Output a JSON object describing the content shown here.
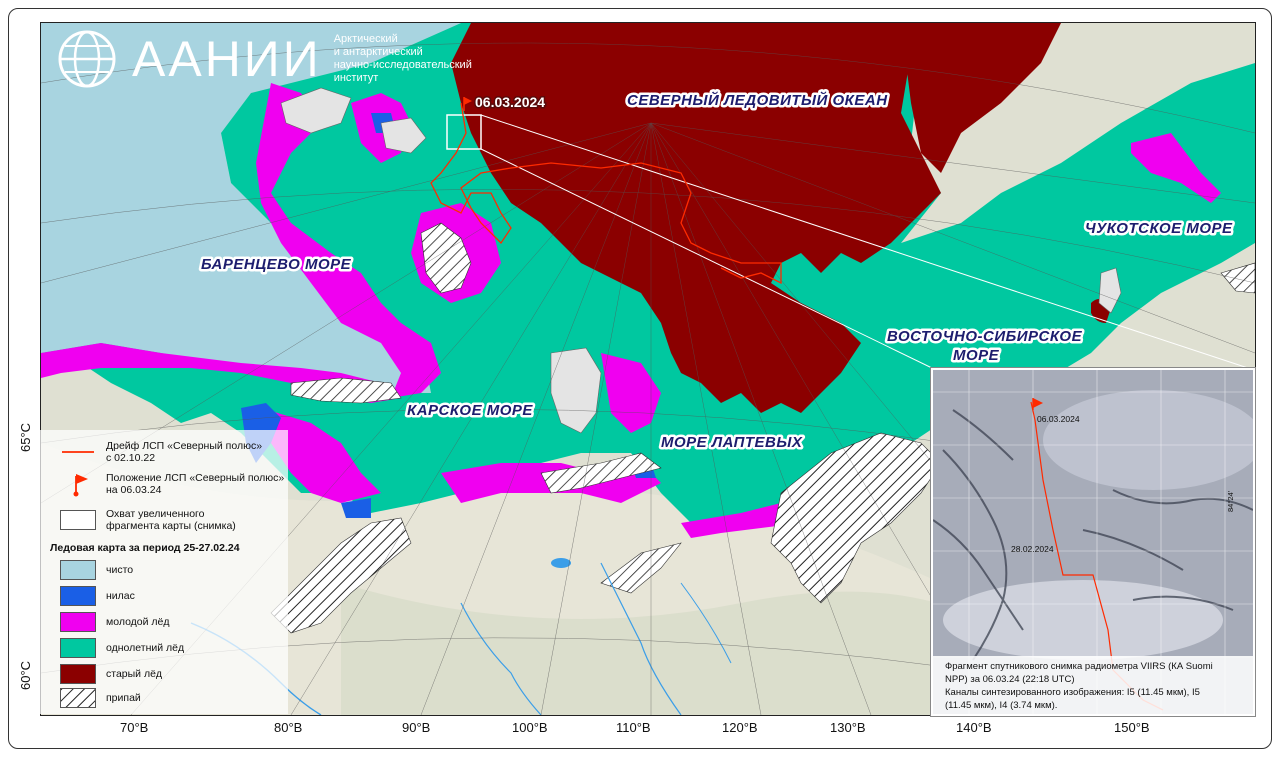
{
  "logo": {
    "name": "ААНИИ",
    "subtitle_lines": [
      "Арктический",
      "и антарктический",
      "научно-исследовательский",
      "институт"
    ]
  },
  "map_labels": {
    "ocean": "СЕВЕРНЫЙ ЛЕДОВИТЫЙ ОКЕАН",
    "barents": "БАРЕНЦЕВО МОРЕ",
    "kara": "КАРСКОЕ МОРЕ",
    "laptev": "МОРЕ ЛАПТЕВЫХ",
    "east_siberian_1": "ВОСТОЧНО-СИБИРСКОЕ",
    "east_siberian_2": "МОРЕ",
    "chukchi": "ЧУКОТСКОЕ МОРЕ",
    "station_date": "06.03.2024"
  },
  "latitudes": [
    "65°С",
    "60°С"
  ],
  "longitudes": [
    "70°В",
    "80°В",
    "90°В",
    "100°В",
    "110°В",
    "120°В",
    "130°В",
    "140°В",
    "150°В"
  ],
  "legend": {
    "drift_label": "Дрейф ЛСП «Северный полюс»\nс 02.10.22",
    "position_label": "Положение ЛСП «Северный полюс»\nна 06.03.24",
    "coverage_label": "Охват увеличенного\nфрагмента карты (снимка)",
    "title": "Ледовая карта за период 25-27.02.24",
    "items": [
      {
        "label": "чисто",
        "color": "#a8d4e0"
      },
      {
        "label": "нилас",
        "color": "#1a5fe6"
      },
      {
        "label": "молодой лёд",
        "color": "#f000f0"
      },
      {
        "label": "однолетний лёд",
        "color": "#00c8a0"
      },
      {
        "label": "старый лёд",
        "color": "#8b0000"
      },
      {
        "label": "припай",
        "color": "hatch"
      }
    ]
  },
  "inset": {
    "date_top": "06.03.2024",
    "date_mid": "28.02.2024",
    "side_label": "84°24'",
    "caption_lines": [
      "Фрагмент спутникового снимка радиометра VIIRS (КА Suomi",
      "NPP) за 06.03.24 (22:18 UTC)",
      "Каналы синтезированного изображения: I5 (11.45 мкм), I5",
      "(11.45 мкм), I4 (3.74 мкм)."
    ]
  },
  "colors": {
    "open_water": "#a8d4e0",
    "nilas": "#1a5fe6",
    "young_ice": "#f000f0",
    "first_year_ice": "#00c8a0",
    "old_ice": "#8b0000",
    "land": "#dcdccf",
    "drift_line": "#ff2a00"
  }
}
